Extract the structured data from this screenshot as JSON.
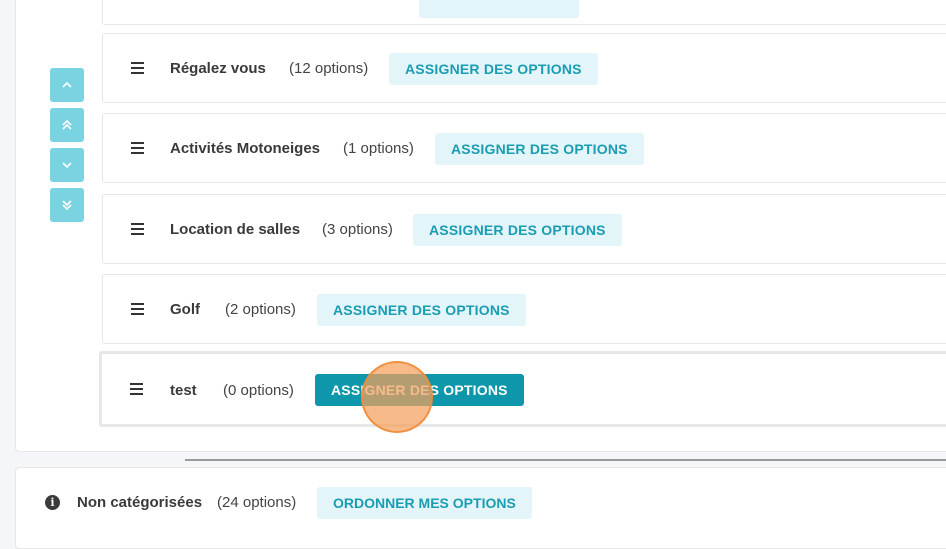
{
  "categories": [
    {
      "name": "Régalez vous",
      "count": "(12 options)",
      "button": "ASSIGNER DES OPTIONS"
    },
    {
      "name": "Activités Motoneiges",
      "count": "(1 options)",
      "button": "ASSIGNER DES OPTIONS"
    },
    {
      "name": "Location de salles",
      "count": "(3 options)",
      "button": "ASSIGNER DES OPTIONS"
    },
    {
      "name": "Golf",
      "count": "(2 options)",
      "button": "ASSIGNER DES OPTIONS"
    },
    {
      "name": "test",
      "count": "(0 options)",
      "button": "ASSIGNER DES OPTIONS"
    }
  ],
  "uncategorized": {
    "name": "Non catégorisées",
    "count": "(24 options)",
    "button": "ORDONNER MES OPTIONS"
  },
  "icons": {
    "move_up": "chevron-up-icon",
    "move_top": "double-chevron-up-icon",
    "move_down": "chevron-down-icon",
    "move_bottom": "double-chevron-down-icon",
    "drag": "drag-handle-icon",
    "info": "info-icon"
  },
  "colors": {
    "accent": "#0e97ab",
    "accent_light": "#e3f5f8",
    "arrow_button": "#79d3e0",
    "click_indicator": "#f5a05a"
  }
}
